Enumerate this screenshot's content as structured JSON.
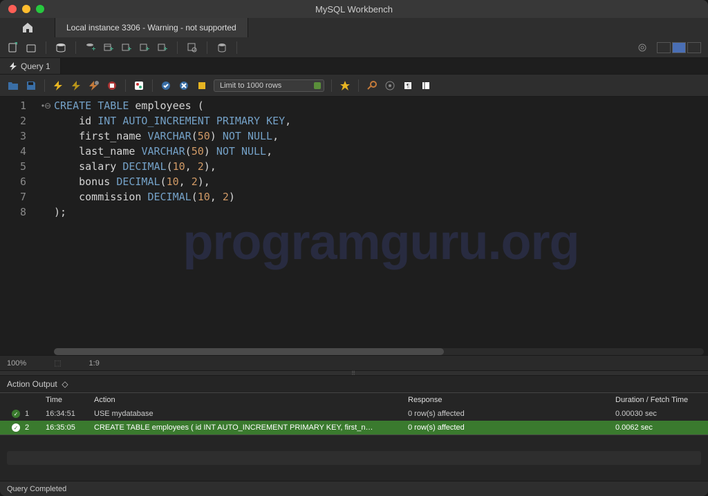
{
  "app": {
    "title": "MySQL Workbench"
  },
  "connection_tab": "Local instance 3306 - Warning - not supported",
  "query_tab": "Query 1",
  "limit_dropdown": "Limit to 1000 rows",
  "code": {
    "lines": [
      "1",
      "2",
      "3",
      "4",
      "5",
      "6",
      "7",
      "8"
    ],
    "l1": {
      "kw1": "CREATE",
      "kw2": "TABLE",
      "id": "employees",
      "p": " ("
    },
    "l2": {
      "id": "id",
      "t": "INT",
      "c1": "AUTO_INCREMENT",
      "c2": "PRIMARY",
      "c3": "KEY",
      "p": ","
    },
    "l3": {
      "id": "first_name",
      "t": "VARCHAR",
      "po": "(",
      "n": "50",
      "pc": ")",
      "c1": "NOT",
      "c2": "NULL",
      "p": ","
    },
    "l4": {
      "id": "last_name",
      "t": "VARCHAR",
      "po": "(",
      "n": "50",
      "pc": ")",
      "c1": "NOT",
      "c2": "NULL",
      "p": ","
    },
    "l5": {
      "id": "salary",
      "t": "DECIMAL",
      "po": "(",
      "n1": "10",
      "c": ", ",
      "n2": "2",
      "pc": ")",
      "p": ","
    },
    "l6": {
      "id": "bonus",
      "t": "DECIMAL",
      "po": "(",
      "n1": "10",
      "c": ", ",
      "n2": "2",
      "pc": ")",
      "p": ","
    },
    "l7": {
      "id": "commission",
      "t": "DECIMAL",
      "po": "(",
      "n1": "10",
      "c": ", ",
      "n2": "2",
      "pc": ")"
    },
    "l8": ");"
  },
  "watermark": "programguru.org",
  "status": {
    "zoom": "100%",
    "cursor": "1:9"
  },
  "output": {
    "panel_label": "Action Output",
    "headers": {
      "time": "Time",
      "action": "Action",
      "response": "Response",
      "duration": "Duration / Fetch Time"
    },
    "rows": [
      {
        "idx": "1",
        "time": "16:34:51",
        "action": "USE mydatabase",
        "response": "0 row(s) affected",
        "duration": "0.00030 sec"
      },
      {
        "idx": "2",
        "time": "16:35:05",
        "action": "CREATE TABLE employees (     id INT AUTO_INCREMENT PRIMARY KEY,     first_n…",
        "response": "0 row(s) affected",
        "duration": "0.0062 sec"
      }
    ]
  },
  "footer": "Query Completed"
}
